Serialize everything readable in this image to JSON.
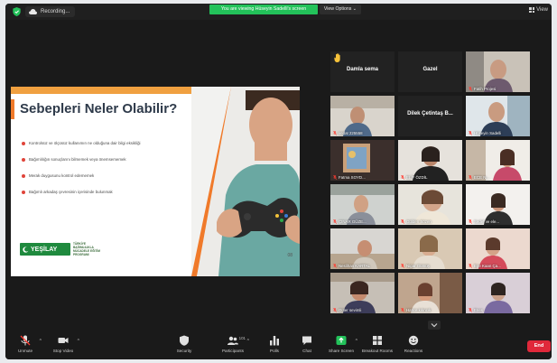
{
  "topbar": {
    "recording_label": "Recording...",
    "viewing_banner": "You are viewing Hüseyin Sadelli's screen",
    "view_options_label": "View Options",
    "view_label": "View"
  },
  "slide": {
    "title": "Sebepleri Neler Olabilir?",
    "bullets": [
      "Kontrolsüz ve ölçüsüz kullanımın ne olduğuna dair bilgi eksikliği",
      "Bağımlılığın sonuçlarını bilmemek veya önemsememek",
      "Merak duygusunu kontrol edememek",
      "Bağımlı arkadaş çevresinin içerisinde bulunmak"
    ],
    "logo_name": "YEŞİLAY",
    "logo_subtext": "TÜRKİYE BAĞIMLILIKLA MÜCADELE EĞİTİM PROGRAMI",
    "page_number": "08"
  },
  "gallery": {
    "tiles": [
      {
        "name": "Damla sema",
        "caption": "",
        "kind": "name",
        "raised_hand": true,
        "active": false
      },
      {
        "name": "Gazel",
        "caption": "",
        "kind": "name",
        "raised_hand": false,
        "active": false
      },
      {
        "name": "",
        "caption": "Fatih Projesi",
        "kind": "video",
        "raised_hand": false,
        "active": false
      },
      {
        "name": "",
        "caption": "vedat 225558",
        "kind": "video",
        "raised_hand": false,
        "active": false
      },
      {
        "name": "Dilek Çetintaş B...",
        "caption": "",
        "kind": "name",
        "raised_hand": false,
        "active": false
      },
      {
        "name": "",
        "caption": "Hüseyin Sadelli",
        "kind": "video",
        "raised_hand": false,
        "active": true
      },
      {
        "name": "",
        "caption": "Fatma SOYD...",
        "kind": "video",
        "raised_hand": false,
        "active": false
      },
      {
        "name": "",
        "caption": "ELİF ÖZDİL",
        "kind": "video",
        "raised_hand": false,
        "active": false
      },
      {
        "name": "",
        "caption": "ECE N...",
        "kind": "video",
        "raised_hand": false,
        "active": false
      },
      {
        "name": "",
        "caption": "ÇINAR GÜZE...",
        "kind": "video",
        "raised_hand": false,
        "active": false
      },
      {
        "name": "",
        "caption": "Gülden Sözen",
        "kind": "video",
        "raised_hand": false,
        "active": false
      },
      {
        "name": "",
        "caption": "Sedef ve ele...",
        "kind": "video",
        "raised_hand": false,
        "active": false
      },
      {
        "name": "",
        "caption": "Neslihan KARTAL",
        "kind": "video",
        "raised_hand": false,
        "active": false
      },
      {
        "name": "",
        "caption": "Nigar Gümüş",
        "kind": "video",
        "raised_hand": false,
        "active": false
      },
      {
        "name": "",
        "caption": "Ege Kaan Ça...",
        "kind": "video",
        "raised_hand": false,
        "active": false
      },
      {
        "name": "",
        "caption": "Güler sevimli",
        "kind": "video",
        "raised_hand": false,
        "active": false
      },
      {
        "name": "",
        "caption": "Hatice kılıncık",
        "kind": "video",
        "raised_hand": false,
        "active": false
      },
      {
        "name": "",
        "caption": "Enes",
        "kind": "video",
        "raised_hand": false,
        "active": false
      }
    ]
  },
  "toolbar": {
    "unmute": "Unmute",
    "stop_video": "Stop Video",
    "security": "Security",
    "participants": "Participants",
    "participants_count": "101",
    "polls": "Polls",
    "chat": "Chat",
    "share_screen": "Share Screen",
    "breakout_rooms": "Breakout Rooms",
    "reactions": "Reactions",
    "end": "End"
  },
  "colors": {
    "share_green": "#23c25a",
    "end_red": "#e0283a",
    "active_speaker": "#e8d84a",
    "slide_accent": "#f07a2a",
    "yesilay_green": "#1f8a3e"
  }
}
